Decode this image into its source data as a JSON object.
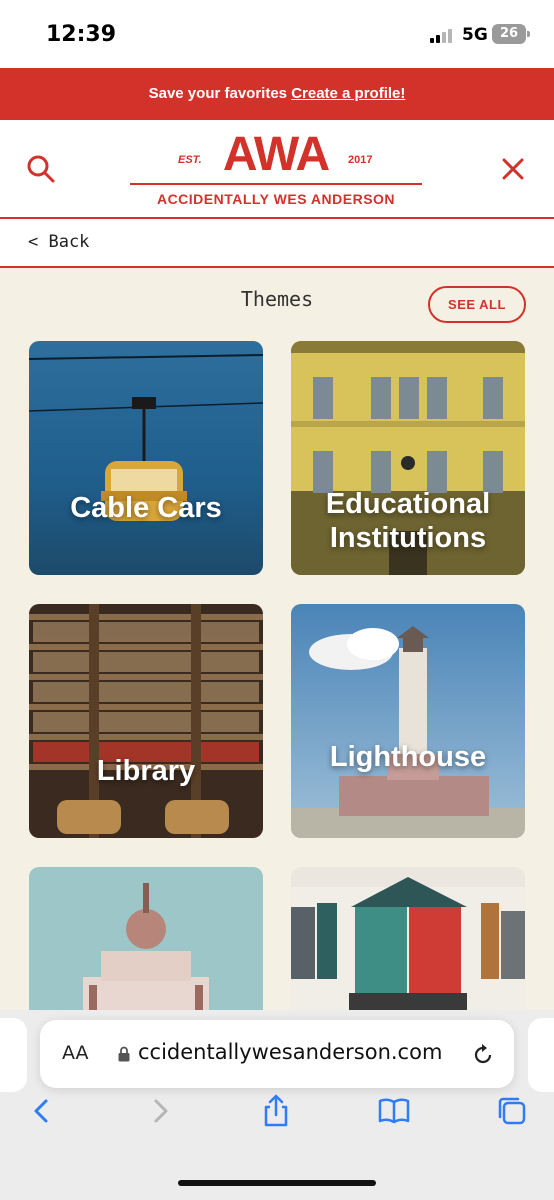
{
  "status_bar": {
    "time": "12:39",
    "network": "5G",
    "battery": "26"
  },
  "promo": {
    "text": "Save your favorites",
    "link": "Create a profile!"
  },
  "header": {
    "logo_main": "AWA",
    "logo_est": "EST.",
    "logo_year": "2017",
    "logo_sub": "ACCIDENTALLY WES ANDERSON",
    "search_icon": "search-icon",
    "close_icon": "close-icon"
  },
  "back": {
    "label": "< Back"
  },
  "themes": {
    "title": "Themes",
    "see_all": "SEE ALL",
    "cards": [
      {
        "label": "Cable Cars"
      },
      {
        "label": "Educational Institutions"
      },
      {
        "label": "Library"
      },
      {
        "label": "Lighthouse"
      },
      {
        "label": ""
      },
      {
        "label": ""
      }
    ]
  },
  "browser": {
    "aa": "AA",
    "url": "ccidentallywesanderson.com",
    "toolbar_icons": [
      "back-icon",
      "forward-icon",
      "share-icon",
      "bookmarks-icon",
      "tabs-icon"
    ]
  },
  "colors": {
    "accent": "#d3322b",
    "background": "#f5f0e4"
  }
}
